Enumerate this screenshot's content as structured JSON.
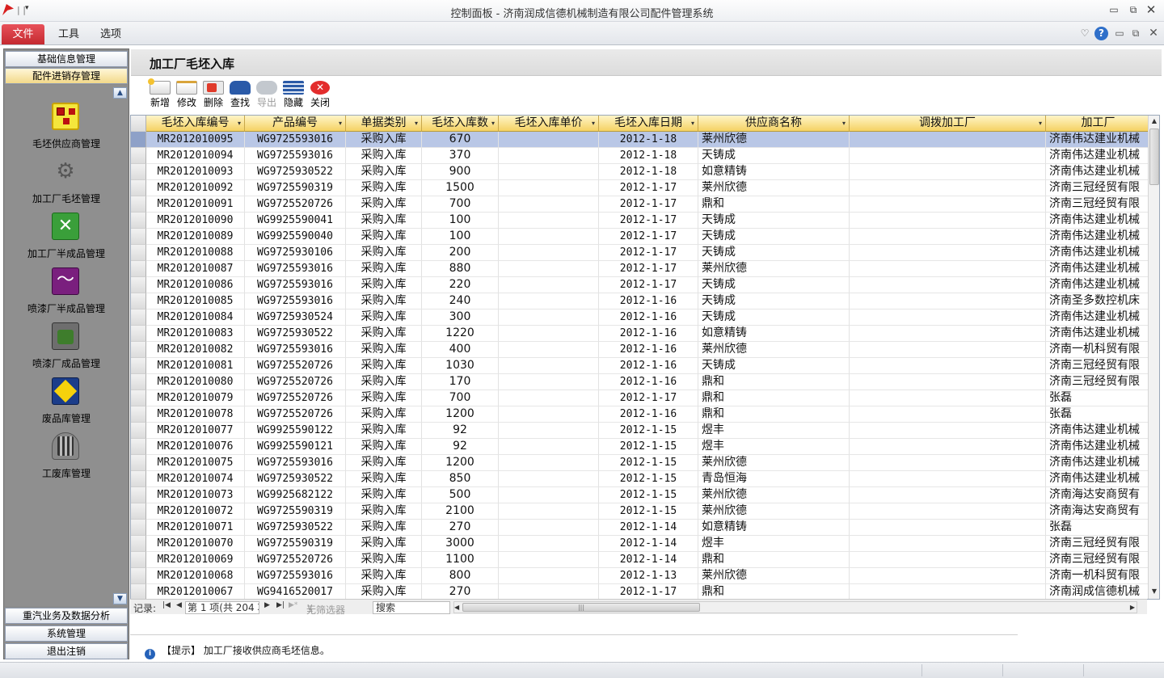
{
  "window": {
    "title": "控制面板 - 济南润成信德机械制造有限公司配件管理系统",
    "min_glyph": "▭",
    "max_glyph": "⧉",
    "close_glyph": "✕",
    "qa_sep": "| |",
    "qa_dropdown": "▾"
  },
  "ribbon": {
    "tabs": [
      "文件",
      "工具",
      "选项"
    ],
    "active_tab": "文件",
    "chevron": "♡",
    "help": "?",
    "min": "▭",
    "restore": "⧉",
    "close": "✕"
  },
  "leftnav": {
    "headers_top": [
      "基础信息管理",
      "配件进销存管理"
    ],
    "headers_bottom": [
      "重汽业务及数据分析",
      "系统管理",
      "退出注销"
    ],
    "scroll_up": "▲",
    "scroll_down": "▼",
    "items": [
      {
        "label": "毛坯供应商管理",
        "icon": "org-chart-icon",
        "glyph": ""
      },
      {
        "label": "加工厂毛坯管理",
        "icon": "gears-icon",
        "glyph": "⚙"
      },
      {
        "label": "加工厂半成品管理",
        "icon": "tools-icon",
        "glyph": "✕"
      },
      {
        "label": "喷漆厂半成品管理",
        "icon": "trend-chart-icon",
        "glyph": "〜"
      },
      {
        "label": "喷漆厂成品管理",
        "icon": "truck-icon",
        "glyph": ""
      },
      {
        "label": "废品库管理",
        "icon": "warning-sign-icon",
        "glyph": ""
      },
      {
        "label": "工废库管理",
        "icon": "trash-bin-icon",
        "glyph": ""
      }
    ]
  },
  "page": {
    "title": "加工厂毛坯入库"
  },
  "toolbar": {
    "buttons": [
      {
        "label": "新增",
        "icon": "new-document-icon",
        "glyph": "",
        "enabled": true
      },
      {
        "label": "修改",
        "icon": "edit-icon",
        "glyph": "",
        "enabled": true
      },
      {
        "label": "删除",
        "icon": "delete-icon",
        "glyph": "",
        "enabled": true
      },
      {
        "label": "查找",
        "icon": "binoculars-icon",
        "glyph": "",
        "enabled": true
      },
      {
        "label": "导出",
        "icon": "export-icon",
        "glyph": "",
        "enabled": false
      },
      {
        "label": "隐藏",
        "icon": "hide-icon",
        "glyph": "",
        "enabled": true
      },
      {
        "label": "关闭",
        "icon": "close-icon",
        "glyph": "✕",
        "enabled": true
      }
    ]
  },
  "grid": {
    "columns": [
      "毛坯入库编号",
      "产品编号",
      "单据类别",
      "毛坯入库数",
      "毛坯入库单价",
      "毛坯入库日期",
      "供应商名称",
      "调拨加工厂",
      "加工厂"
    ],
    "sort_glyph": "▾",
    "rows": [
      [
        "MR2012010095",
        "WG9725593016",
        "采购入库",
        "670",
        "",
        "2012-1-18",
        "莱州欣德",
        "",
        "济南伟达建业机械"
      ],
      [
        "MR2012010094",
        "WG9725593016",
        "采购入库",
        "370",
        "",
        "2012-1-18",
        "天铸成",
        "",
        "济南伟达建业机械"
      ],
      [
        "MR2012010093",
        "WG9725930522",
        "采购入库",
        "900",
        "",
        "2012-1-18",
        "如意精铸",
        "",
        "济南伟达建业机械"
      ],
      [
        "MR2012010092",
        "WG9725590319",
        "采购入库",
        "1500",
        "",
        "2012-1-17",
        "莱州欣德",
        "",
        "济南三冠经贸有限"
      ],
      [
        "MR2012010091",
        "WG9725520726",
        "采购入库",
        "700",
        "",
        "2012-1-17",
        "鼎和",
        "",
        "济南三冠经贸有限"
      ],
      [
        "MR2012010090",
        "WG9925590041",
        "采购入库",
        "100",
        "",
        "2012-1-17",
        "天铸成",
        "",
        "济南伟达建业机械"
      ],
      [
        "MR2012010089",
        "WG9925590040",
        "采购入库",
        "100",
        "",
        "2012-1-17",
        "天铸成",
        "",
        "济南伟达建业机械"
      ],
      [
        "MR2012010088",
        "WG9725930106",
        "采购入库",
        "200",
        "",
        "2012-1-17",
        "天铸成",
        "",
        "济南伟达建业机械"
      ],
      [
        "MR2012010087",
        "WG9725593016",
        "采购入库",
        "880",
        "",
        "2012-1-17",
        "莱州欣德",
        "",
        "济南伟达建业机械"
      ],
      [
        "MR2012010086",
        "WG9725593016",
        "采购入库",
        "220",
        "",
        "2012-1-17",
        "天铸成",
        "",
        "济南伟达建业机械"
      ],
      [
        "MR2012010085",
        "WG9725593016",
        "采购入库",
        "240",
        "",
        "2012-1-16",
        "天铸成",
        "",
        "济南圣多数控机床"
      ],
      [
        "MR2012010084",
        "WG9725930524",
        "采购入库",
        "300",
        "",
        "2012-1-16",
        "天铸成",
        "",
        "济南伟达建业机械"
      ],
      [
        "MR2012010083",
        "WG9725930522",
        "采购入库",
        "1220",
        "",
        "2012-1-16",
        "如意精铸",
        "",
        "济南伟达建业机械"
      ],
      [
        "MR2012010082",
        "WG9725593016",
        "采购入库",
        "400",
        "",
        "2012-1-16",
        "莱州欣德",
        "",
        "济南一机科贸有限"
      ],
      [
        "MR2012010081",
        "WG9725520726",
        "采购入库",
        "1030",
        "",
        "2012-1-16",
        "天铸成",
        "",
        "济南三冠经贸有限"
      ],
      [
        "MR2012010080",
        "WG9725520726",
        "采购入库",
        "170",
        "",
        "2012-1-16",
        "鼎和",
        "",
        "济南三冠经贸有限"
      ],
      [
        "MR2012010079",
        "WG9725520726",
        "采购入库",
        "700",
        "",
        "2012-1-17",
        "鼎和",
        "",
        "张磊"
      ],
      [
        "MR2012010078",
        "WG9725520726",
        "采购入库",
        "1200",
        "",
        "2012-1-16",
        "鼎和",
        "",
        "张磊"
      ],
      [
        "MR2012010077",
        "WG9925590122",
        "采购入库",
        "92",
        "",
        "2012-1-15",
        "煜丰",
        "",
        "济南伟达建业机械"
      ],
      [
        "MR2012010076",
        "WG9925590121",
        "采购入库",
        "92",
        "",
        "2012-1-15",
        "煜丰",
        "",
        "济南伟达建业机械"
      ],
      [
        "MR2012010075",
        "WG9725593016",
        "采购入库",
        "1200",
        "",
        "2012-1-15",
        "莱州欣德",
        "",
        "济南伟达建业机械"
      ],
      [
        "MR2012010074",
        "WG9725930522",
        "采购入库",
        "850",
        "",
        "2012-1-15",
        "青岛恒海",
        "",
        "济南伟达建业机械"
      ],
      [
        "MR2012010073",
        "WG9925682122",
        "采购入库",
        "500",
        "",
        "2012-1-15",
        "莱州欣德",
        "",
        "济南海达安商贸有"
      ],
      [
        "MR2012010072",
        "WG9725590319",
        "采购入库",
        "2100",
        "",
        "2012-1-15",
        "莱州欣德",
        "",
        "济南海达安商贸有"
      ],
      [
        "MR2012010071",
        "WG9725930522",
        "采购入库",
        "270",
        "",
        "2012-1-14",
        "如意精铸",
        "",
        "张磊"
      ],
      [
        "MR2012010070",
        "WG9725590319",
        "采购入库",
        "3000",
        "",
        "2012-1-14",
        "煜丰",
        "",
        "济南三冠经贸有限"
      ],
      [
        "MR2012010069",
        "WG9725520726",
        "采购入库",
        "1100",
        "",
        "2012-1-14",
        "鼎和",
        "",
        "济南三冠经贸有限"
      ],
      [
        "MR2012010068",
        "WG9725593016",
        "采购入库",
        "800",
        "",
        "2012-1-13",
        "莱州欣德",
        "",
        "济南一机科贸有限"
      ],
      [
        "MR2012010067",
        "WG9416520017",
        "采购入库",
        "270",
        "",
        "2012-1-17",
        "鼎和",
        "",
        "济南润成信德机械"
      ]
    ],
    "selected_row": 0,
    "scroll_up": "▲",
    "scroll_down": "▼"
  },
  "navigator": {
    "record_label": "记录:",
    "first": "|◀",
    "prev": "◀",
    "position": "第 1 项(共 204 项)",
    "next": "▶",
    "last": "▶|",
    "new": "▶*",
    "filter": "无筛选器",
    "filter_icon": "funnel-icon",
    "search_placeholder": "搜索",
    "hscroll_left": "◀",
    "hscroll_right": "▶",
    "hscroll_grip": "|||"
  },
  "status": {
    "info": "i",
    "message": "【提示】 加工厂接收供应商毛坯信息。"
  },
  "colors": {
    "file_tab": "#c42a30",
    "header_fill": "#f5d263",
    "selected_row": "#b9c7e6",
    "nav_bg": "#8c8c8c"
  }
}
